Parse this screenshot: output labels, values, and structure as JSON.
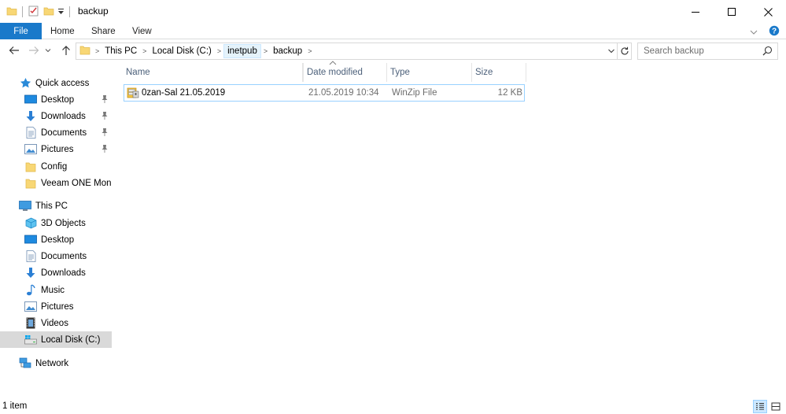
{
  "window": {
    "title": "backup"
  },
  "ribbon": {
    "tabs": [
      {
        "label": "File"
      },
      {
        "label": "Home"
      },
      {
        "label": "Share"
      },
      {
        "label": "View"
      }
    ]
  },
  "address": {
    "crumbs": [
      {
        "label": "This PC"
      },
      {
        "label": "Local Disk (C:)"
      },
      {
        "label": "inetpub"
      },
      {
        "label": "backup"
      }
    ]
  },
  "search": {
    "placeholder": "Search backup"
  },
  "navpane": {
    "items": [
      {
        "label": "Quick access",
        "icon": "star-icon"
      },
      {
        "label": "Desktop",
        "icon": "desktop-icon",
        "pinned": true
      },
      {
        "label": "Downloads",
        "icon": "download-icon",
        "pinned": true
      },
      {
        "label": "Documents",
        "icon": "document-icon",
        "pinned": true
      },
      {
        "label": "Pictures",
        "icon": "pictures-icon",
        "pinned": true
      },
      {
        "label": "Config",
        "icon": "folder-icon"
      },
      {
        "label": "Veeam ONE Monito",
        "icon": "folder-icon"
      },
      {
        "label": "This PC",
        "icon": "computer-icon"
      },
      {
        "label": "3D Objects",
        "icon": "cube-icon"
      },
      {
        "label": "Desktop",
        "icon": "desktop-icon"
      },
      {
        "label": "Documents",
        "icon": "document-icon"
      },
      {
        "label": "Downloads",
        "icon": "download-icon"
      },
      {
        "label": "Music",
        "icon": "music-icon"
      },
      {
        "label": "Pictures",
        "icon": "pictures-icon"
      },
      {
        "label": "Videos",
        "icon": "video-icon"
      },
      {
        "label": "Local Disk (C:)",
        "icon": "drive-icon",
        "selected": true
      },
      {
        "label": "Network",
        "icon": "network-icon"
      }
    ]
  },
  "columns": [
    {
      "label": "Name"
    },
    {
      "label": "Date modified"
    },
    {
      "label": "Type"
    },
    {
      "label": "Size"
    }
  ],
  "files": [
    {
      "name": "0zan-Sal 21.05.2019",
      "date": "21.05.2019 10:34",
      "type": "WinZip File",
      "size": "12 KB",
      "icon": "zip-file-icon"
    }
  ],
  "status": {
    "count": "1 item"
  },
  "colors": {
    "file_tab": "#1979ca",
    "selection_border": "#99d1ff",
    "selected_nav": "#d9d9d9",
    "column_header_text": "#4c607a"
  }
}
